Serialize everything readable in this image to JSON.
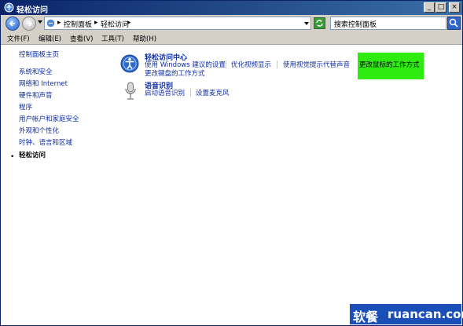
{
  "window": {
    "title": "轻松访问",
    "buttons": {
      "minimize": "_",
      "maximize": "□",
      "close": "×"
    }
  },
  "nav": {
    "breadcrumb": [
      "控制面板",
      "轻松访问"
    ],
    "search_placeholder": "搜索控制面板"
  },
  "menu": [
    "文件(F)",
    "编辑(E)",
    "查看(V)",
    "工具(T)",
    "帮助(H)"
  ],
  "sidebar": [
    "控制面板主页",
    "系统和安全",
    "网络和 Internet",
    "硬件和声音",
    "程序",
    "用户帐户和家庭安全",
    "外观和个性化",
    "时钟、语言和区域",
    "轻松访问"
  ],
  "categories": [
    {
      "title": "轻松访问中心",
      "links": [
        "使用 Windows 建议的设置",
        "优化视频显示",
        "使用视觉提示代替声音",
        "更改鼠标的工作方式"
      ],
      "link2": "更改键盘的工作方式"
    },
    {
      "title": "语音识别",
      "links": [
        "启动语音识别",
        "设置麦克风"
      ]
    }
  ],
  "watermark": {
    "cn": "软餐",
    "en": "ruancan.com"
  },
  "colors": {
    "title_bar": "#0a246a",
    "link": "#0f2ea8",
    "highlight": "#2eeb10",
    "watermark_bg": "#1a4fb8"
  }
}
